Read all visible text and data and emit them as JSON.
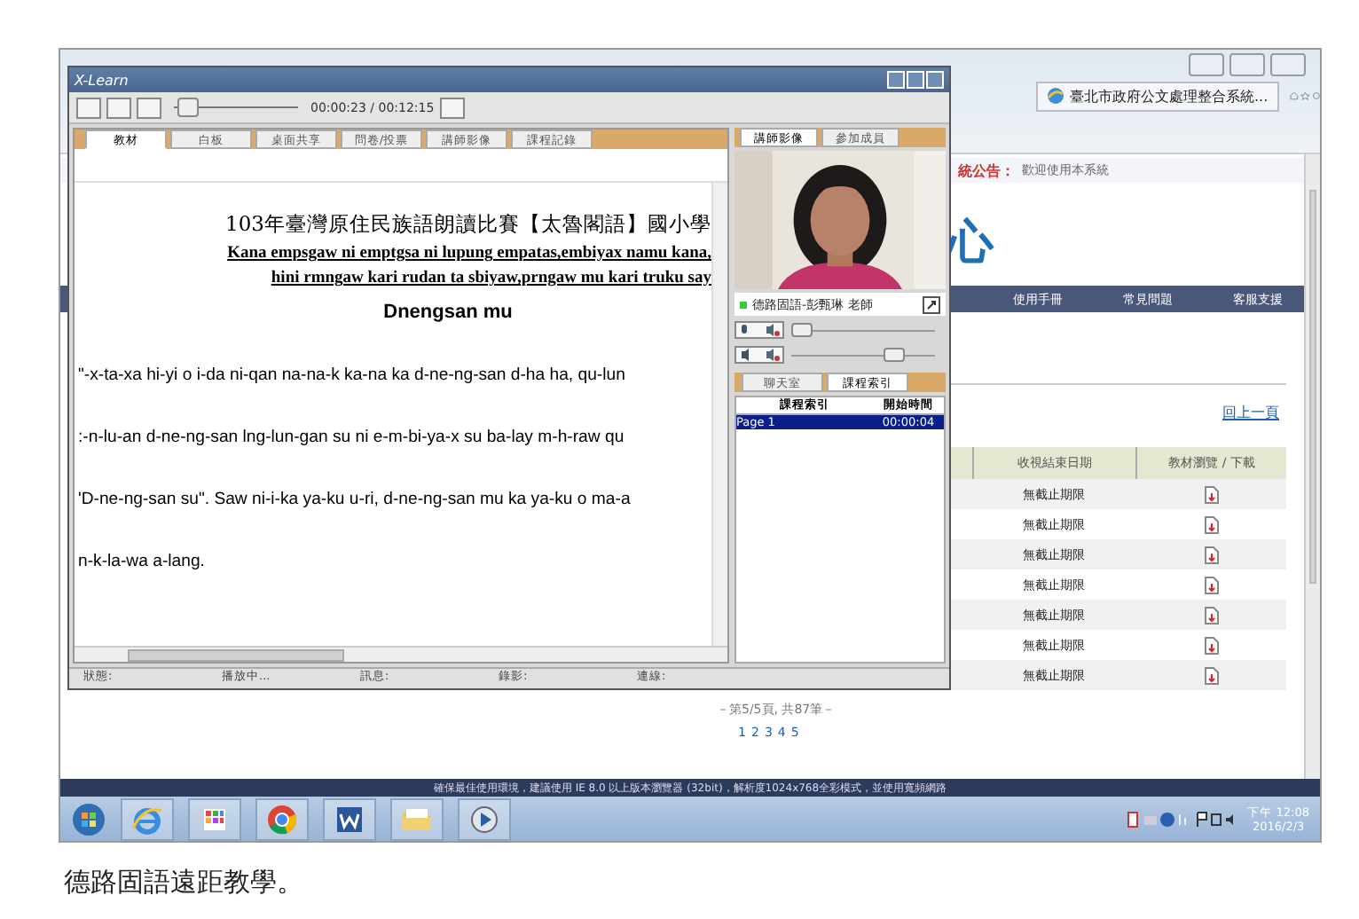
{
  "browser": {
    "tab_title": "臺北市政府公文處理整合系統...",
    "announcement_label": "統公告：",
    "announcement_text": "歡迎使用本系統",
    "heading": "心",
    "nav": [
      "使用手冊",
      "常見問題",
      "客服支援"
    ],
    "back_link": "回上一頁",
    "table": {
      "columns": [
        "收視結束日期",
        "教材瀏覽 / 下載"
      ],
      "rows": [
        {
          "deadline": "無截止期限"
        },
        {
          "deadline": "無截止期限"
        },
        {
          "deadline": "無截止期限"
        },
        {
          "deadline": "無截止期限"
        },
        {
          "deadline": "無截止期限"
        },
        {
          "deadline": "無截止期限"
        },
        {
          "deadline": "無截止期限"
        }
      ]
    },
    "pagination_summary": "－第5/5頁, 共87筆－",
    "pages": [
      "1",
      "2",
      "3",
      "4",
      "5"
    ],
    "footer": "確保最佳使用環境，建議使用 IE 8.0 以上版本瀏覽器 (32bit)，解析度1024x768全彩模式，並使用寬頻網路"
  },
  "player": {
    "title": "X-Learn",
    "time": "00:00:23 / 00:12:15",
    "seek": {
      "level": 0.03
    },
    "mic_volume": {
      "level": 0.0
    },
    "speaker_volume": {
      "level": 0.75
    },
    "tabs": [
      {
        "label": "教材",
        "selected": true
      },
      {
        "label": "白板",
        "selected": false
      },
      {
        "label": "桌面共享",
        "selected": false
      },
      {
        "label": "問卷/投票",
        "selected": false
      },
      {
        "label": "講師影像",
        "selected": false
      },
      {
        "label": "課程記錄",
        "selected": false
      }
    ],
    "content": {
      "title": "103年臺灣原住民族語朗讀比賽【太魯閣語】國小學",
      "verse_lines": [
        "Kana empsgaw ni emptgsa ni lupung empatas,embiyax namu kana,",
        "hini rmngaw kari rudan ta sbiyaw,prngaw mu kari truku say"
      ],
      "subtitle": "Dnengsan mu",
      "lines": [
        "\"-x-ta-xa hi-yi o i-da ni-qan na-na-k ka-na ka d-ne-ng-san d-ha ha, qu-lun",
        ":-n-lu-an d-ne-ng-san lng-lun-gan su ni e-m-bi-ya-x su ba-lay m-h-raw qu",
        "'D-ne-ng-san su\". Saw ni-i-ka ya-ku u-ri, d-ne-ng-san mu ka ya-ku o ma-a",
        "n-k-la-wa a-lang."
      ]
    },
    "video_tabs": [
      {
        "label": "講師影像",
        "selected": true
      },
      {
        "label": "參加成員",
        "selected": false
      }
    ],
    "video_caption": "德路固語-彭甄琳 老師",
    "side_tabs": [
      {
        "label": "聊天室",
        "selected": false
      },
      {
        "label": "課程索引",
        "selected": true
      }
    ],
    "index_table": {
      "columns": [
        "課程索引",
        "開始時間"
      ],
      "rows": [
        {
          "page": "Page 1",
          "time": "00:00:04",
          "selected": true
        }
      ]
    },
    "status_bar": [
      "狀態:",
      "播放中...",
      "訊息:",
      "錄影:",
      "連線:"
    ]
  },
  "taskbar": {
    "time": "下午 12:08",
    "date": "2016/2/3"
  },
  "caption": "德路固語遠距教學。"
}
